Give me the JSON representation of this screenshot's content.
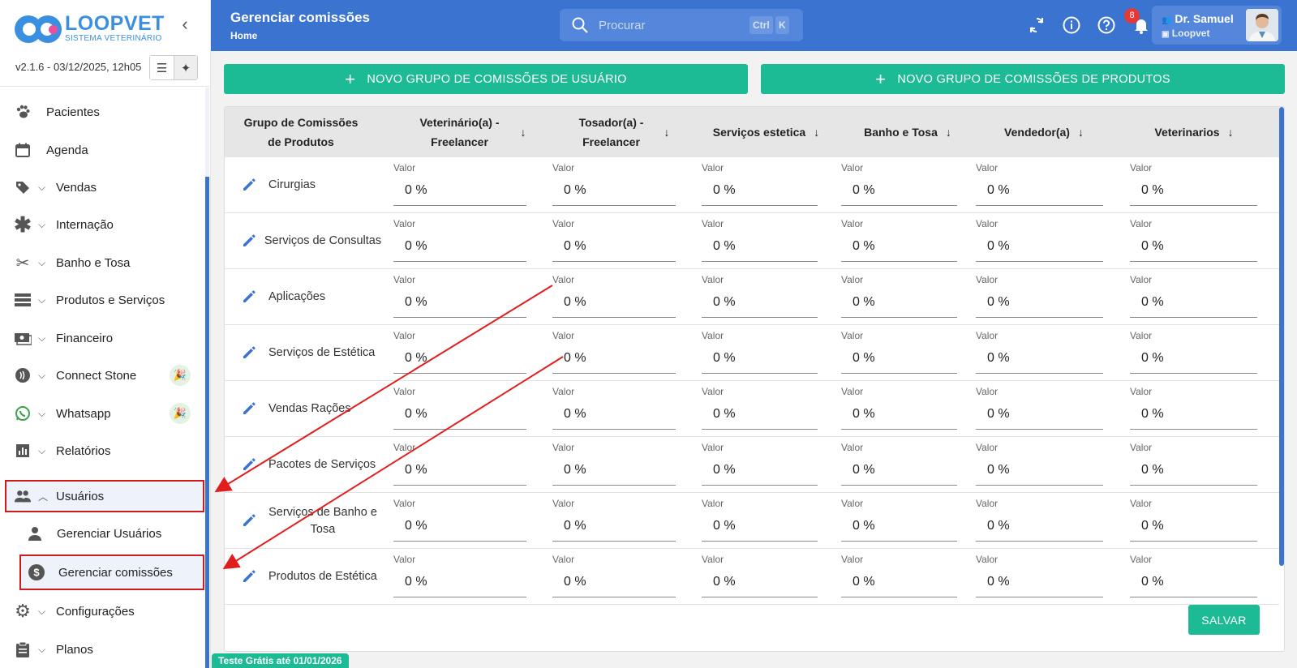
{
  "app": {
    "logo_name": "LOOPVET",
    "logo_sub": "SISTEMA VETERINÁRIO",
    "version": "v2.1.6 - 03/12/2025, 12h05"
  },
  "sidebar": {
    "items": [
      {
        "label": "Pacientes",
        "icon": "paw-icon"
      },
      {
        "label": "Agenda",
        "icon": "calendar-icon"
      },
      {
        "label": "Vendas",
        "icon": "tag-icon"
      },
      {
        "label": "Internação",
        "icon": "asterisk-icon"
      },
      {
        "label": "Banho e Tosa",
        "icon": "scissors-icon"
      },
      {
        "label": "Produtos e Serviços",
        "icon": "list-icon"
      },
      {
        "label": "Financeiro",
        "icon": "money-icon"
      },
      {
        "label": "Connect Stone",
        "icon": "contactless-icon"
      },
      {
        "label": "Whatsapp",
        "icon": "whatsapp-icon"
      },
      {
        "label": "Relatórios",
        "icon": "bar-chart-icon"
      },
      {
        "label": "Usuários",
        "icon": "users-icon"
      },
      {
        "label": "Configurações",
        "icon": "gear-icon"
      },
      {
        "label": "Planos",
        "icon": "clipboard-icon"
      }
    ],
    "subitems": [
      {
        "label": "Gerenciar Usuários",
        "icon": "person-icon"
      },
      {
        "label": "Gerenciar comissões",
        "icon": "dollar-circle-icon"
      }
    ]
  },
  "header": {
    "title": "Gerenciar comissões",
    "breadcrumb": "Home",
    "search_placeholder": "Procurar",
    "kbd_ctrl": "Ctrl",
    "kbd_k": "K",
    "notifications": "8",
    "user_name": "Dr. Samuel",
    "user_org": "Loopvet"
  },
  "actions": {
    "new_user_group": "NOVO GRUPO DE COMISSÕES DE USUÁRIO",
    "new_product_group": "NOVO GRUPO DE COMISSÕES DE PRODUTOS",
    "save": "SALVAR"
  },
  "table": {
    "columns": [
      "Grupo de Comissões de Produtos",
      "Veterinário(a) - Freelancer",
      "Tosador(a) - Freelancer",
      "Serviços estetica",
      "Banho e Tosa",
      "Vendedor(a)",
      "Veterinarios"
    ],
    "field_label": "Valor",
    "rows": [
      {
        "group": "Cirurgias",
        "values": [
          "0 %",
          "0 %",
          "0 %",
          "0 %",
          "0 %",
          "0 %"
        ]
      },
      {
        "group": "Serviços de Consultas",
        "values": [
          "0 %",
          "0 %",
          "0 %",
          "0 %",
          "0 %",
          "0 %"
        ]
      },
      {
        "group": "Aplicações",
        "values": [
          "0 %",
          "0 %",
          "0 %",
          "0 %",
          "0 %",
          "0 %"
        ]
      },
      {
        "group": "Serviços de Estética",
        "values": [
          "0 %",
          "0 %",
          "0 %",
          "0 %",
          "0 %",
          "0 %"
        ]
      },
      {
        "group": "Vendas Rações",
        "values": [
          "0 %",
          "0 %",
          "0 %",
          "0 %",
          "0 %",
          "0 %"
        ]
      },
      {
        "group": "Pacotes de Serviços",
        "values": [
          "0 %",
          "0 %",
          "0 %",
          "0 %",
          "0 %",
          "0 %"
        ]
      },
      {
        "group": "Serviços de Banho e Tosa",
        "values": [
          "0 %",
          "0 %",
          "0 %",
          "0 %",
          "0 %",
          "0 %"
        ]
      },
      {
        "group": "Produtos de Estética",
        "values": [
          "0 %",
          "0 %",
          "0 %",
          "0 %",
          "0 %",
          "0 %"
        ]
      }
    ]
  },
  "footer": {
    "trial": "Teste Grátis até 01/01/2026"
  },
  "colors": {
    "primary": "#3b73d1",
    "accent": "#1dbb95",
    "highlight": "#d01b1b"
  }
}
